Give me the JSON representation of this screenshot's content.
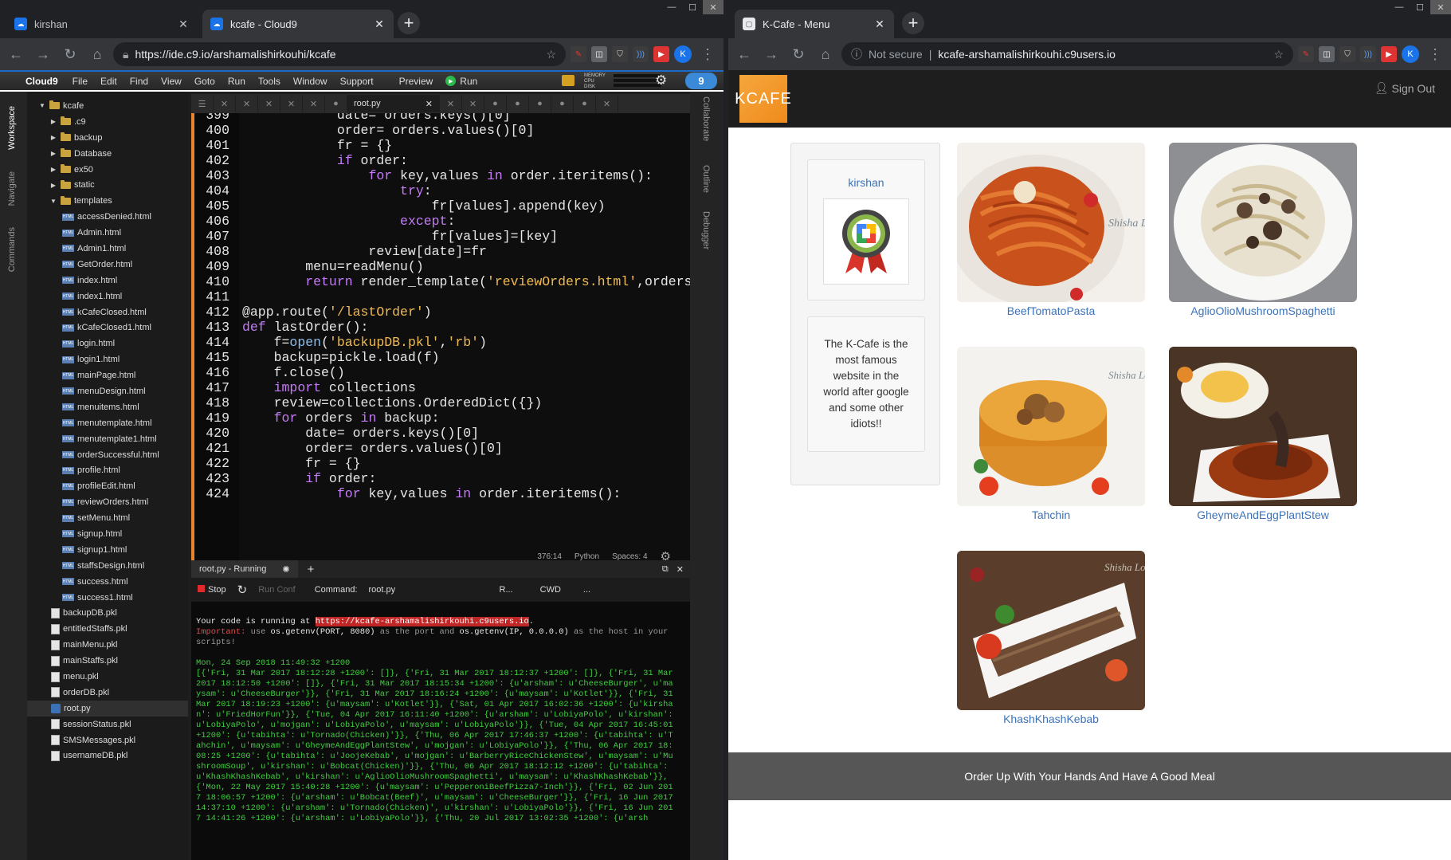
{
  "left_browser": {
    "tabs": [
      {
        "title": "kirshan",
        "active": false
      },
      {
        "title": "kcafe - Cloud9",
        "active": true
      }
    ],
    "url": "https://ide.c9.io/arshamalishirkouhi/kcafe",
    "avatar_letter": "K"
  },
  "cloud9": {
    "menu": [
      "Cloud9",
      "File",
      "Edit",
      "Find",
      "View",
      "Goto",
      "Run",
      "Tools",
      "Window",
      "Support",
      "Preview",
      "Run"
    ],
    "mem_labels": [
      "MEMORY",
      "CPU",
      "DISK"
    ],
    "side_tabs": [
      "Workspace",
      "Navigate",
      "Commands"
    ],
    "right_tabs": [
      "Collaborate",
      "Outline",
      "Debugger"
    ],
    "tree": [
      {
        "name": "kcafe",
        "type": "folder",
        "open": true,
        "depth": 0
      },
      {
        "name": ".c9",
        "type": "folder",
        "depth": 1
      },
      {
        "name": "backup",
        "type": "folder",
        "depth": 1
      },
      {
        "name": "Database",
        "type": "folder",
        "depth": 1
      },
      {
        "name": "ex50",
        "type": "folder",
        "depth": 1
      },
      {
        "name": "static",
        "type": "folder",
        "depth": 1
      },
      {
        "name": "templates",
        "type": "folder",
        "open": true,
        "depth": 1
      },
      {
        "name": "accessDenied.html",
        "type": "html",
        "depth": 2
      },
      {
        "name": "Admin.html",
        "type": "html",
        "depth": 2
      },
      {
        "name": "Admin1.html",
        "type": "html",
        "depth": 2
      },
      {
        "name": "GetOrder.html",
        "type": "html",
        "depth": 2
      },
      {
        "name": "index.html",
        "type": "html",
        "depth": 2
      },
      {
        "name": "index1.html",
        "type": "html",
        "depth": 2
      },
      {
        "name": "kCafeClosed.html",
        "type": "html",
        "depth": 2
      },
      {
        "name": "kCafeClosed1.html",
        "type": "html",
        "depth": 2
      },
      {
        "name": "login.html",
        "type": "html",
        "depth": 2
      },
      {
        "name": "login1.html",
        "type": "html",
        "depth": 2
      },
      {
        "name": "mainPage.html",
        "type": "html",
        "depth": 2
      },
      {
        "name": "menuDesign.html",
        "type": "html",
        "depth": 2
      },
      {
        "name": "menuitems.html",
        "type": "html",
        "depth": 2
      },
      {
        "name": "menutemplate.html",
        "type": "html",
        "depth": 2
      },
      {
        "name": "menutemplate1.html",
        "type": "html",
        "depth": 2
      },
      {
        "name": "orderSuccessful.html",
        "type": "html",
        "depth": 2
      },
      {
        "name": "profile.html",
        "type": "html",
        "depth": 2
      },
      {
        "name": "profileEdit.html",
        "type": "html",
        "depth": 2
      },
      {
        "name": "reviewOrders.html",
        "type": "html",
        "depth": 2
      },
      {
        "name": "setMenu.html",
        "type": "html",
        "depth": 2
      },
      {
        "name": "signup.html",
        "type": "html",
        "depth": 2
      },
      {
        "name": "signup1.html",
        "type": "html",
        "depth": 2
      },
      {
        "name": "staffsDesign.html",
        "type": "html",
        "depth": 2
      },
      {
        "name": "success.html",
        "type": "html",
        "depth": 2
      },
      {
        "name": "success1.html",
        "type": "html",
        "depth": 2
      },
      {
        "name": "backupDB.pkl",
        "type": "pkl",
        "depth": 1
      },
      {
        "name": "entitledStaffs.pkl",
        "type": "pkl",
        "depth": 1
      },
      {
        "name": "mainMenu.pkl",
        "type": "pkl",
        "depth": 1
      },
      {
        "name": "mainStaffs.pkl",
        "type": "pkl",
        "depth": 1
      },
      {
        "name": "menu.pkl",
        "type": "pkl",
        "depth": 1
      },
      {
        "name": "orderDB.pkl",
        "type": "pkl",
        "depth": 1
      },
      {
        "name": "root.py",
        "type": "py",
        "depth": 1,
        "selected": true
      },
      {
        "name": "sessionStatus.pkl",
        "type": "pkl",
        "depth": 1
      },
      {
        "name": "SMSMessages.pkl",
        "type": "pkl",
        "depth": 1
      },
      {
        "name": "usernameDB.pkl",
        "type": "pkl",
        "depth": 1
      }
    ],
    "editor_tab": "root.py",
    "code_lines": [
      {
        "n": "399",
        "t": "            date= orders.keys()[0]"
      },
      {
        "n": "400",
        "t": "            order= orders.values()[0]"
      },
      {
        "n": "401",
        "t": "            fr = {}"
      },
      {
        "n": "402",
        "t": "            if order:"
      },
      {
        "n": "403",
        "t": "                for key,values in order.iteritems():"
      },
      {
        "n": "404",
        "t": "                    try:"
      },
      {
        "n": "405",
        "t": "                        fr[values].append(key)"
      },
      {
        "n": "406",
        "t": "                    except:"
      },
      {
        "n": "407",
        "t": "                        fr[values]=[key]"
      },
      {
        "n": "408",
        "t": "                review[date]=fr"
      },
      {
        "n": "409",
        "t": "        menu=readMenu()"
      },
      {
        "n": "410",
        "t": "        return render_template('reviewOrders.html',orders=r"
      },
      {
        "n": "411",
        "t": ""
      },
      {
        "n": "412",
        "t": "@app.route('/lastOrder')"
      },
      {
        "n": "413",
        "t": "def lastOrder():"
      },
      {
        "n": "414",
        "t": "    f=open('backupDB.pkl','rb')"
      },
      {
        "n": "415",
        "t": "    backup=pickle.load(f)"
      },
      {
        "n": "416",
        "t": "    f.close()"
      },
      {
        "n": "417",
        "t": "    import collections"
      },
      {
        "n": "418",
        "t": "    review=collections.OrderedDict({})"
      },
      {
        "n": "419",
        "t": "    for orders in backup:"
      },
      {
        "n": "420",
        "t": "        date= orders.keys()[0]"
      },
      {
        "n": "421",
        "t": "        order= orders.values()[0]"
      },
      {
        "n": "422",
        "t": "        fr = {}"
      },
      {
        "n": "423",
        "t": "        if order:"
      },
      {
        "n": "424",
        "t": "            for key,values in order.iteritems():"
      }
    ],
    "status": {
      "pos": "376:14",
      "lang": "Python",
      "spaces": "Spaces: 4"
    },
    "terminal": {
      "tab": "root.py - Running",
      "stop": "Stop",
      "run_conf": "Run Conf",
      "command_label": "Command:",
      "command": "root.py",
      "runner": "R...",
      "cwd": "CWD",
      "more": "...",
      "running_prefix": "Your code is running at ",
      "running_url": "https://kcafe-arshamalishirkouhi.c9users.io",
      "running_suffix": ".",
      "important_label": "Important:",
      "important_1": " use ",
      "important_2": "os.getenv(PORT, 8080)",
      "important_3": " as the port and ",
      "important_4": "os.getenv(IP, 0.0.0.0)",
      "important_5": " as the host in your scripts!",
      "date_line": "Mon, 24 Sep 2018 11:49:32 +1200",
      "dump": "[{'Fri, 31 Mar 2017 18:12:28 +1200': []}, {'Fri, 31 Mar 2017 18:12:37 +1200': []}, {'Fri, 31 Mar 2017 18:12:50 +1200': []}, {'Fri, 31 Mar 2017 18:15:34 +1200': {u'arsham': u'CheeseBurger', u'maysam': u'CheeseBurger'}}, {'Fri, 31 Mar 2017 18:16:24 +1200': {u'maysam': u'Kotlet'}}, {'Fri, 31 Mar 2017 18:19:23 +1200': {u'maysam': u'Kotlet'}}, {'Sat, 01 Apr 2017 16:02:36 +1200': {u'kirshan': u'FriedHorFun'}}, {'Tue, 04 Apr 2017 16:11:40 +1200': {u'arsham': u'LobiyaPolo', u'kirshan': u'LobiyaPolo', u'mojgan': u'LobiyaPolo', u'maysam': u'LobiyaPolo'}}, {'Tue, 04 Apr 2017 16:45:01 +1200': {u'tabihta': u'Tornado(Chicken)'}}, {'Thu, 06 Apr 2017 17:46:37 +1200': {u'tabihta': u'Tahchin', u'maysam': u'GheymeAndEggPlantStew', u'mojgan': u'LobiyaPolo'}}, {'Thu, 06 Apr 2017 18:08:25 +1200': {u'tabihta': u'JoojeKebab', u'mojgan': u'BarberryRiceChickenStew', u'maysam': u'MushroomSoup', u'kirshan': u'Bobcat(Chicken)'}}, {'Thu, 06 Apr 2017 18:12:12 +1200': {u'tabihta': u'KhashKhashKebab', u'kirshan': u'AglioOlioMushroomSpaghetti', u'maysam': u'KhashKhashKebab'}}, {'Mon, 22 May 2017 15:40:28 +1200': {u'maysam': u'PepperoniBeefPizza7-Inch'}}, {'Fri, 02 Jun 2017 18:06:57 +1200': {u'arsham': u'Bobcat(Beef)', u'maysam': u'CheeseBurger'}}, {'Fri, 16 Jun 2017 14:37:10 +1200': {u'arsham': u'Tornado(Chicken)', u'kirshan': u'LobiyaPolo'}}, {'Fri, 16 Jun 2017 14:41:26 +1200': {u'arsham': u'LobiyaPolo'}}, {'Thu, 20 Jul 2017 13:02:35 +1200': {u'arsh"
    }
  },
  "right_browser": {
    "tabs": [
      {
        "title": "K-Cafe - Menu",
        "active": true
      }
    ],
    "not_secure": "Not secure",
    "url": "kcafe-arshamalishirkouhi.c9users.io",
    "avatar_letter": "K"
  },
  "kcafe": {
    "logo": "KCAFE",
    "signout": "Sign Out",
    "username": "kirshan",
    "about": "The K-Cafe is the most famous website in the world after google and some other idiots!!",
    "menu_items": [
      "BeefTomatoPasta",
      "AglioOlioMushroomSpaghetti",
      "Tahchin",
      "GheymeAndEggPlantStew",
      "KhashKhashKebab"
    ],
    "watermark": "Shisha Lounge",
    "footer": "Order Up With Your Hands And Have A Good Meal"
  }
}
